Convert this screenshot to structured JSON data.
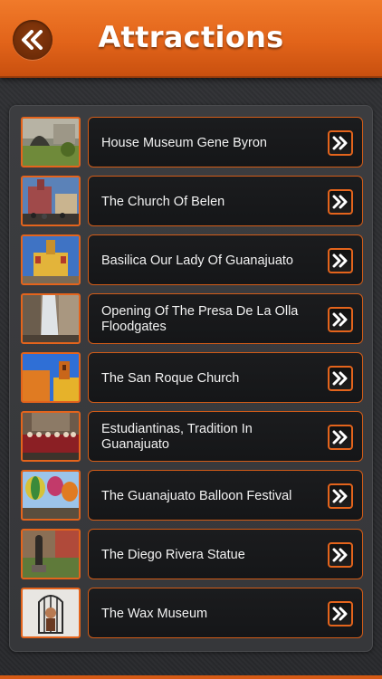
{
  "header": {
    "title": "Attractions",
    "back_icon": "double-chevron-left-icon",
    "color": "#e2641a"
  },
  "attractions": [
    {
      "name": "House Museum Gene Byron",
      "photo": "stone-courtyard-garden"
    },
    {
      "name": "The Church Of Belen",
      "photo": "church-facade-crowd"
    },
    {
      "name": "Basilica Our Lady Of Guanajuato",
      "photo": "yellow-basilica"
    },
    {
      "name": "Opening Of The Presa De La Olla Floodgates",
      "photo": "dam-floodgates"
    },
    {
      "name": "The San Roque Church",
      "photo": "orange-church-tower"
    },
    {
      "name": "Estudiantinas, Tradition In Guanajuato",
      "photo": "estudiantinas-musicians"
    },
    {
      "name": "The Guanajuato Balloon Festival",
      "photo": "hot-air-balloons"
    },
    {
      "name": "The Diego Rivera Statue",
      "photo": "bronze-statue"
    },
    {
      "name": "The Wax Museum",
      "photo": "wax-figure-cage"
    }
  ],
  "row_action_icon": "double-chevron-right-icon",
  "accent": "#e4641c"
}
